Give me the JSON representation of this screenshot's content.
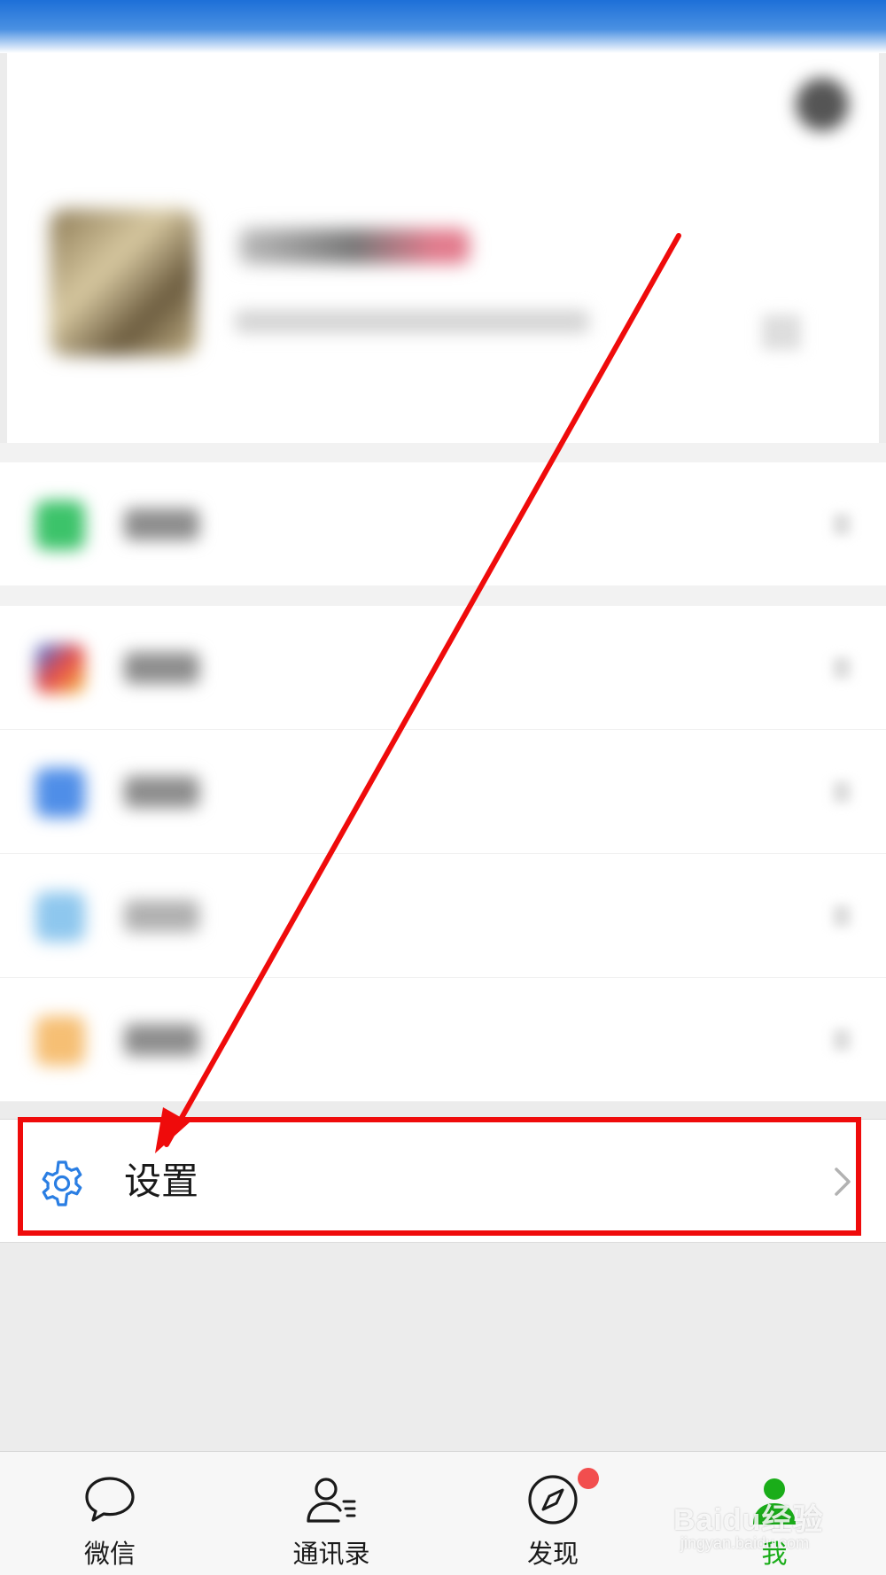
{
  "settings_row": {
    "label": "设置",
    "icon": "gear-icon",
    "chevron": "chevron-right-icon",
    "icon_color": "#2a7ee3"
  },
  "annotation": {
    "box_color": "#ef0b0b",
    "arrow_color": "#ef0b0b"
  },
  "tabbar": {
    "active_color": "#1aad19",
    "tabs": [
      {
        "label": "微信",
        "icon": "chat-bubble-icon",
        "active": false
      },
      {
        "label": "通讯录",
        "icon": "contacts-icon",
        "active": false
      },
      {
        "label": "发现",
        "icon": "compass-icon",
        "active": false,
        "badge": true
      },
      {
        "label": "我",
        "icon": "person-icon",
        "active": true
      }
    ]
  },
  "watermark": {
    "main": "Baidu经验",
    "sub": "jingyan.baidu.com"
  }
}
